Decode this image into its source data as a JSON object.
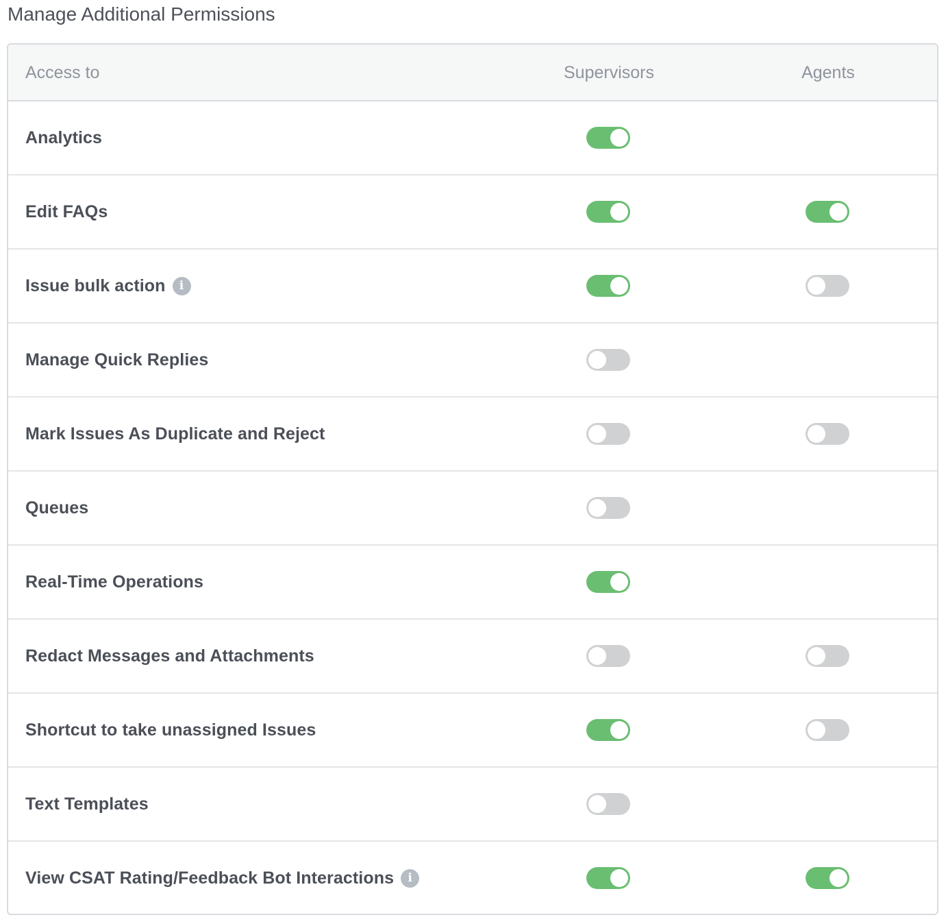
{
  "page": {
    "title": "Manage Additional Permissions"
  },
  "table": {
    "headers": {
      "access_to": "Access to",
      "supervisors": "Supervisors",
      "agents": "Agents"
    },
    "rows": [
      {
        "label": "Analytics",
        "info_icon": false,
        "supervisors": true,
        "agents": null
      },
      {
        "label": "Edit FAQs",
        "info_icon": false,
        "supervisors": true,
        "agents": true
      },
      {
        "label": "Issue bulk action",
        "info_icon": true,
        "supervisors": true,
        "agents": false
      },
      {
        "label": "Manage Quick Replies",
        "info_icon": false,
        "supervisors": false,
        "agents": null
      },
      {
        "label": "Mark Issues As Duplicate and Reject",
        "info_icon": false,
        "supervisors": false,
        "agents": false
      },
      {
        "label": "Queues",
        "info_icon": false,
        "supervisors": false,
        "agents": null
      },
      {
        "label": "Real-Time Operations",
        "info_icon": false,
        "supervisors": true,
        "agents": null
      },
      {
        "label": "Redact Messages and Attachments",
        "info_icon": false,
        "supervisors": false,
        "agents": false
      },
      {
        "label": "Shortcut to take unassigned Issues",
        "info_icon": false,
        "supervisors": true,
        "agents": false
      },
      {
        "label": "Text Templates",
        "info_icon": false,
        "supervisors": false,
        "agents": null
      },
      {
        "label": "View CSAT Rating/Feedback Bot Interactions",
        "info_icon": true,
        "supervisors": true,
        "agents": true
      }
    ]
  },
  "icons": {
    "info": "info-icon",
    "info_glyph": "i"
  },
  "colors": {
    "toggle_on": "#6abe71",
    "toggle_off": "#cfd1d3",
    "header_bg": "#f6f7f7",
    "border": "#d8dbdf"
  }
}
